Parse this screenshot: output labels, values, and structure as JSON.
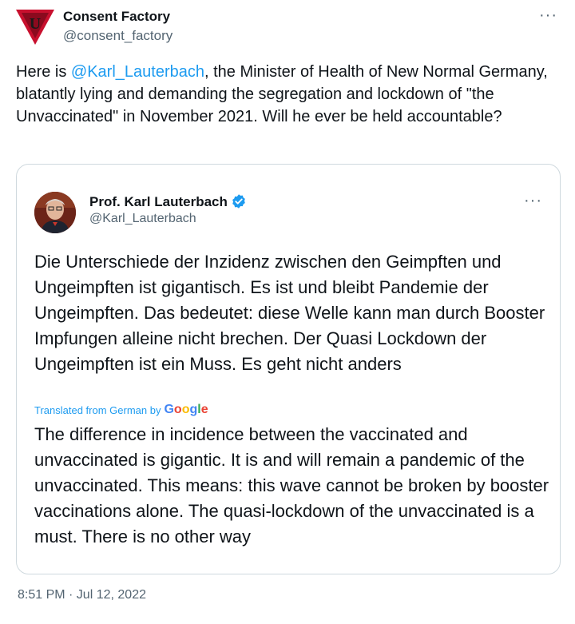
{
  "tweet": {
    "author_name": "Consent Factory",
    "author_handle": "@consent_factory",
    "avatar_letter": "U",
    "more_label": "···",
    "text_before": "Here is ",
    "mention": "@Karl_Lauterbach",
    "text_after": ", the Minister of Health of New Normal Germany, blatantly lying and demanding the segregation and lockdown of \"the Unvaccinated\" in November 2021. Will he ever be held accountable?",
    "timestamp": "8:51 PM · Jul 12, 2022"
  },
  "quote": {
    "author_name": "Prof. Karl Lauterbach",
    "author_handle": "@Karl_Lauterbach",
    "more_label": "···",
    "original_text": "Die Unterschiede der Inzidenz zwischen den Geimpften und Ungeimpften ist gigantisch. Es ist und bleibt Pandemie der Ungeimpften. Das bedeutet: diese Welle kann man durch Booster Impfungen alleine nicht brechen. Der Quasi Lockdown der Ungeimpften ist ein Muss. Es geht nicht anders",
    "translated_label": "Translated from German by",
    "translation": "The difference in incidence between the vaccinated and unvaccinated is gigantic. It is and will remain a pandemic of the unvaccinated. This means: this wave cannot be broken by booster vaccinations alone. The quasi-lockdown of the unvaccinated is a must. There is no other way"
  },
  "colors": {
    "link": "#1d9bf0",
    "secondary_text": "#536471",
    "border": "#cfd9de",
    "logo_red": "#c8102e"
  },
  "icons": [
    "consent-factory-logo-icon",
    "verified-badge-icon",
    "more-options-icon",
    "google-logo-icon"
  ]
}
